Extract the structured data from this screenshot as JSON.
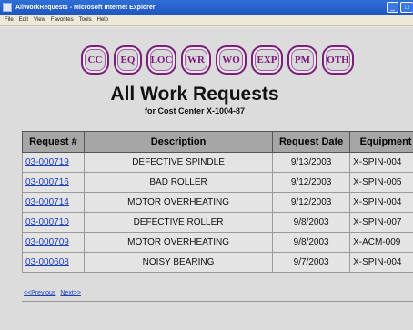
{
  "window": {
    "title": "AllWorkRequests - Microsoft Internet Explorer"
  },
  "menu": [
    "File",
    "Edit",
    "View",
    "Favorites",
    "Tools",
    "Help"
  ],
  "nav_buttons": [
    "CC",
    "EQ",
    "LOC",
    "WR",
    "WO",
    "EXP",
    "PM",
    "OTH"
  ],
  "page": {
    "title": "All Work Requests",
    "subtitle": "for Cost Center X-1004-87"
  },
  "table": {
    "headers": [
      "Request #",
      "Description",
      "Request Date",
      "Equipment"
    ],
    "rows": [
      [
        "03-000719",
        "DEFECTIVE SPINDLE",
        "9/13/2003",
        "X-SPIN-004"
      ],
      [
        "03-000716",
        "BAD ROLLER",
        "9/12/2003",
        "X-SPIN-005"
      ],
      [
        "03-000714",
        "MOTOR OVERHEATING",
        "9/12/2003",
        "X-SPIN-004"
      ],
      [
        "03-000710",
        "DEFECTIVE ROLLER",
        "9/8/2003",
        "X-SPIN-007"
      ],
      [
        "03-000709",
        "MOTOR OVERHEATING",
        "9/8/2003",
        "X-ACM-009"
      ],
      [
        "03-000608",
        "NOISY BEARING",
        "9/7/2003",
        "X-SPIN-004"
      ]
    ]
  },
  "pager": {
    "previous": "<<Previous",
    "next": "Next>>"
  },
  "colors": {
    "titlebar": "#1f56bf",
    "button_text": "#7a1a7a",
    "link": "#1a3fc1"
  }
}
